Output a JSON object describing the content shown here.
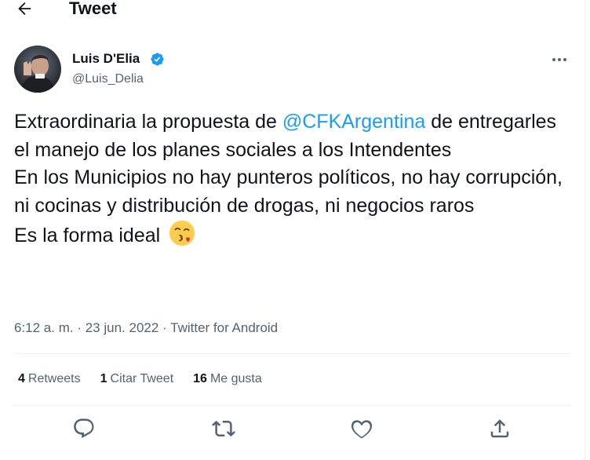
{
  "header": {
    "title": "Tweet"
  },
  "author": {
    "name": "Luis D'Elia",
    "handle": "@Luis_Delia"
  },
  "tweet": {
    "text_before": "Extraordinaria la propuesta de ",
    "mention": "@CFKArgentina",
    "text_after": " de entregarles el manejo de los planes sociales a los Intendentes\nEn los Municipios no hay punteros políticos, no hay corrupción, ni cocinas y distribución de drogas, ni negocios raros\nEs la forma ideal ",
    "emoji": "face-blowing-a-kiss"
  },
  "meta": {
    "time": "6:12 a. m.",
    "separator": " · ",
    "date": "23 jun. 2022",
    "source": "Twitter for Android"
  },
  "stats": {
    "retweets": {
      "count": "4",
      "label": "Retweets"
    },
    "quotes": {
      "count": "1",
      "label": "Citar Tweet"
    },
    "likes": {
      "count": "16",
      "label": "Me gusta"
    }
  },
  "colors": {
    "accent": "#1d9bf0",
    "secondary_text": "#536471",
    "divider": "#eff3f4"
  },
  "icons": [
    "back-arrow-icon",
    "verified-badge-icon",
    "more-icon",
    "reply-icon",
    "retweet-icon",
    "like-icon",
    "share-icon"
  ]
}
